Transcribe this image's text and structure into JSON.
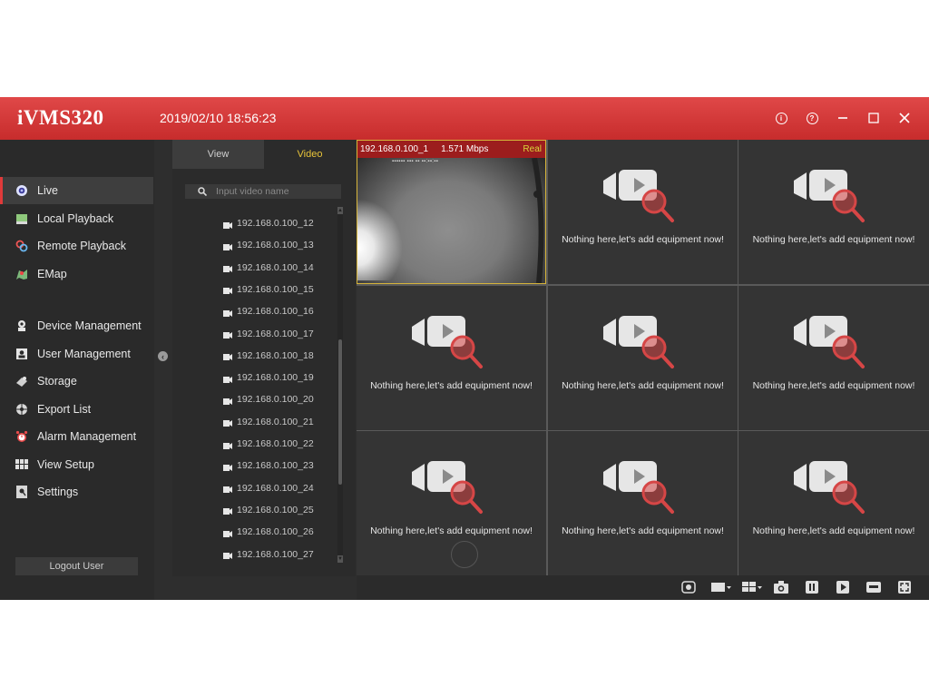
{
  "app": {
    "title": "iVMS320",
    "datetime": "2019/02/10 18:56:23"
  },
  "window_controls": [
    "info-icon",
    "help-icon",
    "minimize-icon",
    "maximize-icon",
    "close-icon"
  ],
  "sidebar": {
    "items": [
      {
        "label": "Live",
        "icon": "live-icon",
        "active": true
      },
      {
        "label": "Local Playback",
        "icon": "local-playback-icon"
      },
      {
        "label": "Remote Playback",
        "icon": "remote-playback-icon"
      },
      {
        "label": "EMap",
        "icon": "emap-icon"
      },
      {
        "label": "Device Management",
        "icon": "device-management-icon"
      },
      {
        "label": "User Management",
        "icon": "user-management-icon"
      },
      {
        "label": "Storage",
        "icon": "storage-icon"
      },
      {
        "label": "Export List",
        "icon": "export-list-icon"
      },
      {
        "label": "Alarm Management",
        "icon": "alarm-icon"
      },
      {
        "label": "View Setup",
        "icon": "view-setup-icon"
      },
      {
        "label": "Settings",
        "icon": "settings-icon"
      }
    ],
    "logout_label": "Logout User"
  },
  "panel": {
    "tabs": [
      {
        "label": "View"
      },
      {
        "label": "Video",
        "active": true
      }
    ],
    "search_placeholder": "Input video name",
    "devices": [
      "192.168.0.100_12",
      "192.168.0.100_13",
      "192.168.0.100_14",
      "192.168.0.100_15",
      "192.168.0.100_16",
      "192.168.0.100_17",
      "192.168.0.100_18",
      "192.168.0.100_19",
      "192.168.0.100_20",
      "192.168.0.100_21",
      "192.168.0.100_22",
      "192.168.0.100_23",
      "192.168.0.100_24",
      "192.168.0.100_25",
      "192.168.0.100_26",
      "192.168.0.100_27"
    ]
  },
  "grid": {
    "live_cell": {
      "ip": "192.168.0.100_1",
      "bitrate": "1.571 Mbps",
      "status": "Real"
    },
    "empty_message": "Nothing here,let's add equipment now!"
  },
  "toolbar": [
    "record-icon",
    "window-layout-icon",
    "split-layout-icon",
    "snapshot-icon",
    "pause-icon",
    "play-icon",
    "ptz-icon",
    "fullscreen-icon"
  ],
  "colors": {
    "title_bar": "#c72c2c",
    "accent_tab": "#e8c43a",
    "selection_border": "#d6b43a"
  }
}
